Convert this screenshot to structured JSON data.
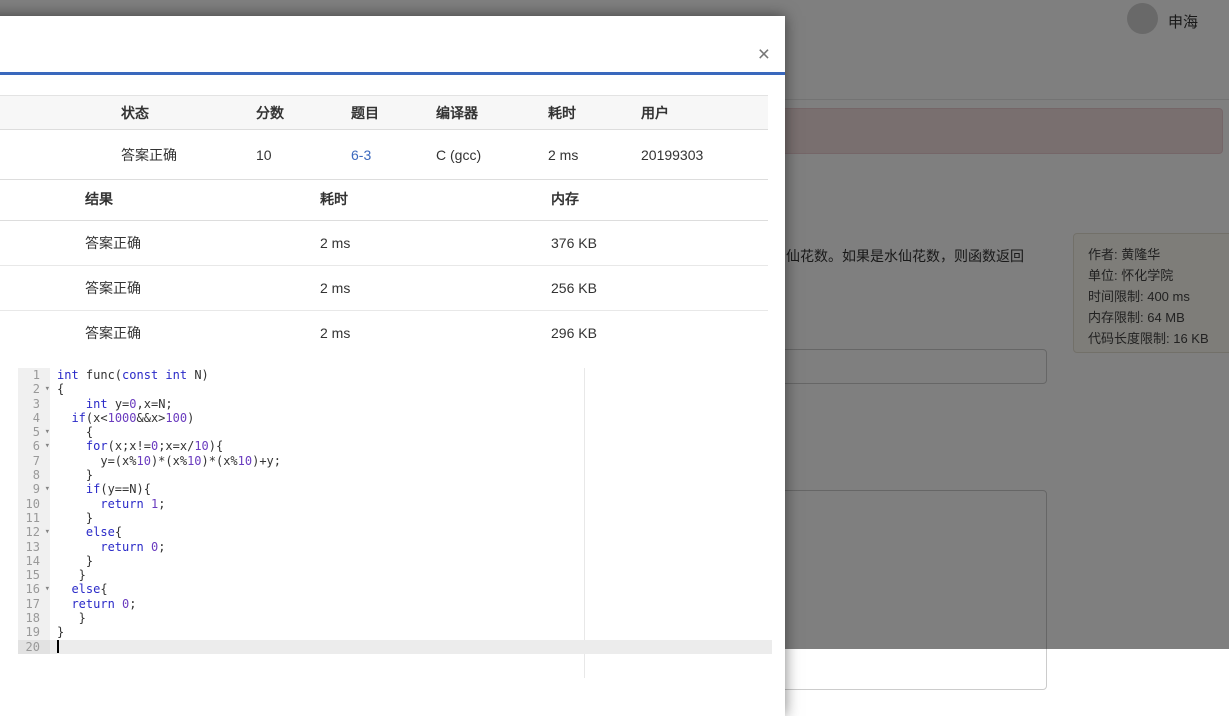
{
  "colors": {
    "accent": "#3a68bd",
    "status_red": "#de4a41",
    "link_blue": "#3c69be",
    "code_keyword": "#2a2ac8",
    "code_number": "#6a3bbf"
  },
  "page": {
    "navbar": {
      "username": "申海"
    },
    "description_fragment": "仙花数。如果是水仙花数，则函数返回",
    "info_panel": {
      "lines": [
        "作者: 黄隆华",
        "单位: 怀化学院",
        "时间限制: 400 ms",
        "内存限制: 64 MB",
        "代码长度限制: 16 KB"
      ]
    }
  },
  "modal": {
    "close_label": "×",
    "submission_table": {
      "columns": [
        "状态",
        "分数",
        "题目",
        "编译器",
        "耗时",
        "用户"
      ],
      "row": {
        "status": "答案正确",
        "score": "10",
        "problem": "6-3",
        "compiler": "C (gcc)",
        "time": "2 ms",
        "user": "20199303"
      }
    },
    "cases_table": {
      "columns": [
        "结果",
        "耗时",
        "内存"
      ],
      "rows": [
        {
          "result": "答案正确",
          "time": "2 ms",
          "memory": "376 KB"
        },
        {
          "result": "答案正确",
          "time": "2 ms",
          "memory": "256 KB"
        },
        {
          "result": "答案正确",
          "time": "2 ms",
          "memory": "296 KB"
        }
      ]
    },
    "code_editor": {
      "language": "c",
      "active_line": 20,
      "fold_lines": [
        2,
        5,
        6,
        9,
        12,
        16
      ],
      "lines": [
        "int func(const int N)",
        "{",
        "    int y=0,x=N;",
        "  if(x<1000&&x>100)",
        "    {",
        "    for(x;x!=0;x=x/10){",
        "      y=(x%10)*(x%10)*(x%10)+y;",
        "    }",
        "    if(y==N){",
        "      return 1;",
        "    }",
        "    else{",
        "      return 0;",
        "    }",
        "   }",
        "  else{",
        "  return 0;",
        "   }",
        "}",
        ""
      ]
    }
  }
}
